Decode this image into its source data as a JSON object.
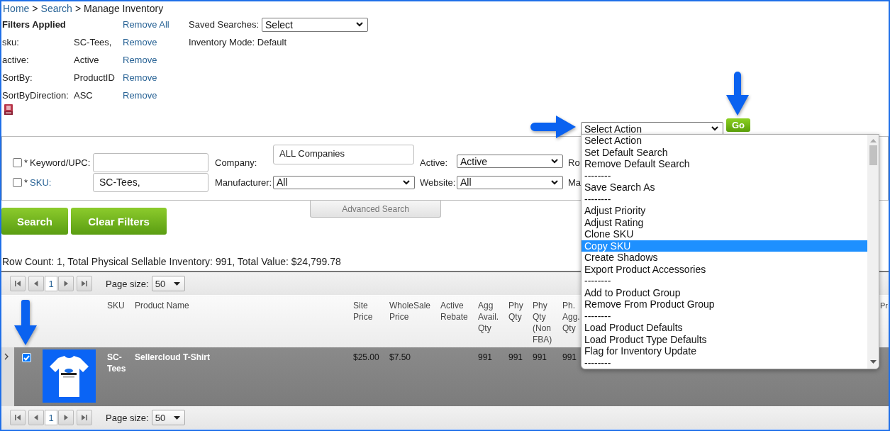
{
  "breadcrumb": [
    {
      "kind": "link",
      "text": "Home"
    },
    {
      "kind": "separator",
      "text": ">"
    },
    {
      "kind": "link",
      "text": "Search"
    },
    {
      "kind": "separator",
      "text": ">"
    },
    {
      "kind": "current",
      "text": "Manage Inventory"
    }
  ],
  "filters": {
    "title": "Filters Applied",
    "remove_all": "Remove All",
    "rows": [
      {
        "name": "sku:",
        "value": "SC-Tees,",
        "action": "Remove"
      },
      {
        "name": "active:",
        "value": "Active",
        "action": "Remove"
      },
      {
        "name": "SortBy:",
        "value": "ProductID",
        "action": "Remove"
      },
      {
        "name": "SortByDirection:",
        "value": "ASC",
        "action": "Remove"
      }
    ]
  },
  "saved_searches": {
    "label": "Saved Searches:",
    "value": "Select"
  },
  "inventory_mode": "Inventory Mode: Default",
  "action_bar": {
    "value": "Select Action",
    "go": "Go"
  },
  "search_panel": {
    "rows": [
      [
        {
          "kind": "check",
          "checked": false,
          "mark": "*",
          "label": "Keyword/UPC:",
          "link": false
        },
        {
          "kind": "input"
        },
        {
          "kind": "label",
          "text": "Company:"
        },
        {
          "kind": "textarea",
          "value": "ALL Companies"
        },
        {
          "kind": "label",
          "text": "Active:"
        },
        {
          "kind": "select",
          "value": "Active"
        },
        {
          "kind": "label",
          "text": "Ro"
        }
      ],
      [
        {
          "kind": "check",
          "checked": false,
          "mark": "*",
          "label": "SKU:",
          "link": true
        },
        {
          "kind": "input",
          "value": "SC-Tees,"
        },
        {
          "kind": "label",
          "text": "Manufacturer:"
        },
        {
          "kind": "select",
          "value": "All"
        },
        {
          "kind": "label",
          "text": "Website:"
        },
        {
          "kind": "select",
          "value": "All"
        },
        {
          "kind": "label",
          "text": "Ma"
        }
      ]
    ]
  },
  "advanced_search": "Advanced Search",
  "buttons": [
    "Search",
    "Clear Filters"
  ],
  "summary": "Row Count: 1, Total Physical Sellable Inventory: 991, Total Value: $24,799.78",
  "grid": {
    "pager_top": {
      "page": "1",
      "page_size_label": "Page size:",
      "page_size": "50"
    },
    "columns": [
      "SKU",
      "Product Name",
      "Site Price",
      "WholeSale Price",
      "Active Rebate",
      "Agg Avail. Qty",
      "Phy Qty",
      "Phy Qty (Non FBA)",
      "Ph. Agg. Qty",
      "Pr"
    ],
    "rows": [
      {
        "checked": true,
        "sku": "SC-Tees",
        "product_name": "Sellercloud T-Shirt",
        "site_price": "$25.00",
        "wholesale_price": "$7.50",
        "agg_avail_qty": "991",
        "phy_qty": "991",
        "phy_qty_non_fba": "991",
        "ph_agg_qty": "991"
      }
    ],
    "pager_bottom": {
      "page": "1",
      "page_size_label": "Page size:",
      "page_size": "50"
    }
  },
  "action_menu": {
    "items": [
      {
        "text": "Select Action",
        "selected": false
      },
      {
        "text": "Set Default Search",
        "selected": false
      },
      {
        "text": "Remove Default Search",
        "selected": false
      },
      {
        "text": "--------",
        "selected": false
      },
      {
        "text": "Save Search As",
        "selected": false
      },
      {
        "text": "--------",
        "selected": false
      },
      {
        "text": "Adjust Priority",
        "selected": false
      },
      {
        "text": "Adjust Rating",
        "selected": false
      },
      {
        "text": "Clone SKU",
        "selected": false
      },
      {
        "text": "Copy SKU",
        "selected": true
      },
      {
        "text": "Create Shadows",
        "selected": false
      },
      {
        "text": "Export Product Accessories",
        "selected": false
      },
      {
        "text": "--------",
        "selected": false
      },
      {
        "text": "Add to Product Group",
        "selected": false
      },
      {
        "text": "Remove From Product Group",
        "selected": false
      },
      {
        "text": "--------",
        "selected": false
      },
      {
        "text": "Load Product Defaults",
        "selected": false
      },
      {
        "text": "Load Product Type Defaults",
        "selected": false
      },
      {
        "text": "Flag for Inventory Update",
        "selected": false
      },
      {
        "text": "--------",
        "selected": false
      }
    ]
  }
}
